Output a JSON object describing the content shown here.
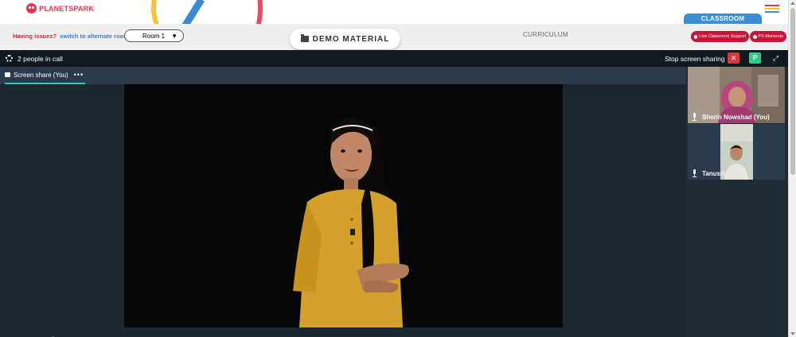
{
  "app": {
    "logo_text_part1": "PLANET",
    "logo_text_part2": "SPARK",
    "classroom_tab": "CLASSROOM",
    "colors": {
      "brand_red": "#e8354b",
      "brand_blue": "#3d8fd1",
      "pill_red": "#c7153a",
      "call_bg": "#1f2b35",
      "accent_teal": "#3ec7b9"
    }
  },
  "subheader": {
    "issues_text": "Having issues?",
    "switch_link": "switch to alternate room",
    "room_selected": "Room 1",
    "demo_button": "DEMO MATERIAL",
    "curriculum": "CURRICULUM",
    "pills": {
      "support": "Live Classroom Support",
      "moments": "PS Moments"
    }
  },
  "call": {
    "people_in_call": "2 people in call",
    "stop_sharing": "Stop screen sharing",
    "stop_icon": "✕",
    "p_badge": "P",
    "share_tab_label": "Screen share (You)",
    "share_more": "•••",
    "participants": [
      {
        "name": "Sherin Nowshad (You)"
      },
      {
        "name": "Tanusri"
      }
    ]
  },
  "icons": [
    "gear-icon",
    "close-icon",
    "expand-icon",
    "mic-icon",
    "folder-icon",
    "more-icon",
    "menu-icon"
  ]
}
